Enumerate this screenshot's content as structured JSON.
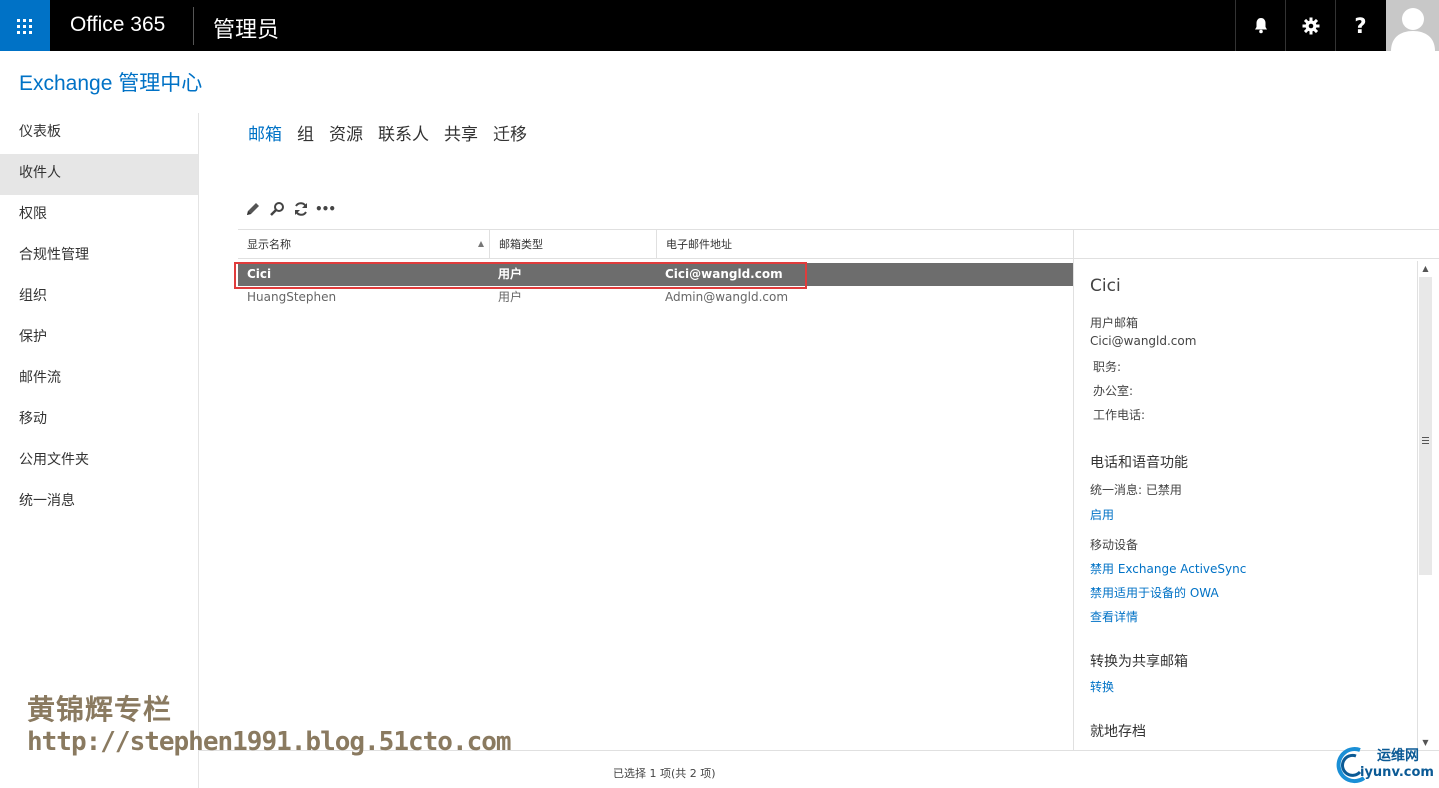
{
  "topbar": {
    "brand": "Office 365",
    "app_title": "管理员",
    "notifications_icon": "bell-icon",
    "settings_icon": "gear-icon",
    "help_icon": "help-icon",
    "help_label": "?"
  },
  "header": {
    "title": "Exchange 管理中心"
  },
  "leftnav": {
    "items": [
      {
        "label": "仪表板"
      },
      {
        "label": "收件人",
        "selected": true
      },
      {
        "label": "权限"
      },
      {
        "label": "合规性管理"
      },
      {
        "label": "组织"
      },
      {
        "label": "保护"
      },
      {
        "label": "邮件流"
      },
      {
        "label": "移动"
      },
      {
        "label": "公用文件夹"
      },
      {
        "label": "统一消息"
      }
    ]
  },
  "tabs": [
    {
      "label": "邮箱",
      "active": true
    },
    {
      "label": "组"
    },
    {
      "label": "资源"
    },
    {
      "label": "联系人"
    },
    {
      "label": "共享"
    },
    {
      "label": "迁移"
    }
  ],
  "toolbar": {
    "edit_icon": "pencil-icon",
    "search_icon": "search-icon",
    "refresh_icon": "refresh-icon",
    "more_label": "•••"
  },
  "table": {
    "columns": [
      "显示名称",
      "邮箱类型",
      "电子邮件地址"
    ],
    "rows": [
      {
        "name": "Cici",
        "type": "用户",
        "email": "Cici@wangld.com",
        "selected": true
      },
      {
        "name": "HuangStephen",
        "type": "用户",
        "email": "Admin@wangld.com"
      }
    ]
  },
  "details": {
    "title": "Cici",
    "mailbox_label": "用户邮箱",
    "email": "Cici@wangld.com",
    "job_title": "职务:",
    "office": "办公室:",
    "work_phone": "工作电话:",
    "phone_voice_heading": "电话和语音功能",
    "um_status": "统一消息:  已禁用",
    "enable_link": "启用",
    "mobile_devices_label": "移动设备",
    "disable_eas_link": "禁用 Exchange ActiveSync",
    "disable_owa_link": "禁用适用于设备的 OWA",
    "view_details_link": "查看详情",
    "convert_heading": "转换为共享邮箱",
    "convert_link": "转换",
    "archive_heading": "就地存档"
  },
  "status": {
    "text": "已选择 1 项(共 2 项)"
  },
  "watermark": {
    "name": "黄锦辉专栏",
    "url": "http://stephen1991.blog.51cto.com",
    "logo_cn": "运维网",
    "logo_en": "iyunv.com"
  },
  "colors": {
    "accent": "#0072c6",
    "topbar": "#000000",
    "selected_row": "#6d6d6d",
    "highlight": "#e03c3c"
  }
}
